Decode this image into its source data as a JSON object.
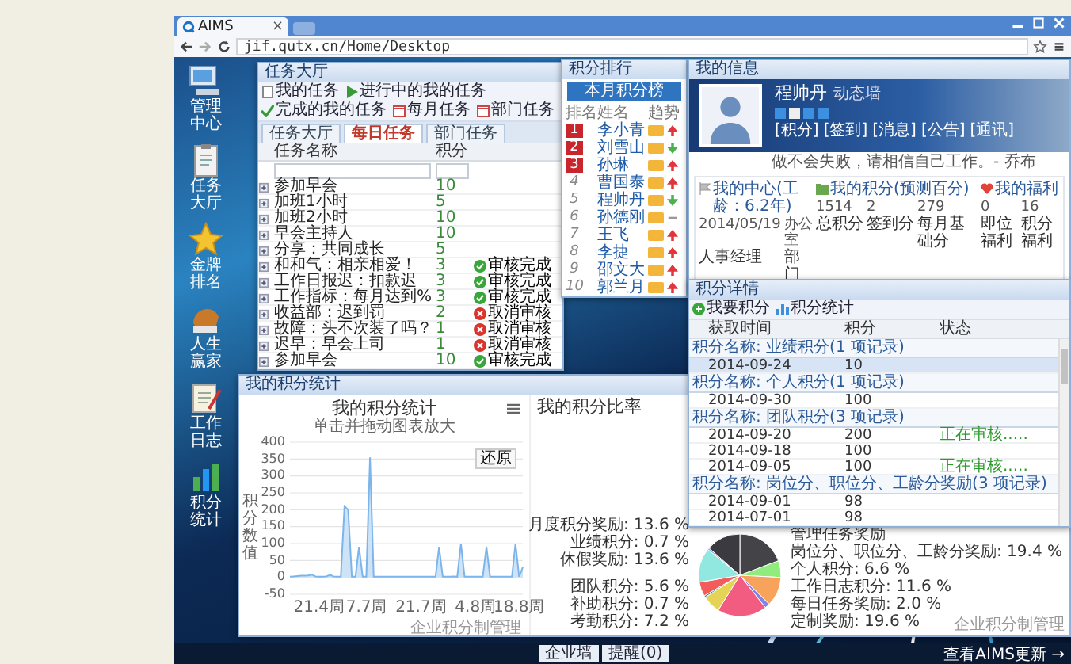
{
  "browser": {
    "tab_title": "AIMS",
    "tab_close": "×",
    "address": "jif.qutx.cn/Home/Desktop"
  },
  "desktop_icons": [
    {
      "label": "管理中心",
      "kind": "computer"
    },
    {
      "label": "任务大厅",
      "kind": "clipboard"
    },
    {
      "label": "金牌排名",
      "kind": "star"
    },
    {
      "label": "人生赢家",
      "kind": "glove"
    },
    {
      "label": "工作日志",
      "kind": "notepad"
    },
    {
      "label": "积分统计",
      "kind": "chart"
    }
  ],
  "task_window": {
    "title": "任务大厅",
    "toolbar": [
      {
        "label": "我的任务",
        "kind": "page"
      },
      {
        "label": "进行中的我的任务",
        "kind": "play"
      },
      {
        "label": "完成的我的任务",
        "kind": "check"
      },
      {
        "label": "每月任务",
        "kind": "calendar"
      },
      {
        "label": "部门任务",
        "kind": "calendar"
      }
    ],
    "tabs": [
      {
        "label": "任务大厅",
        "selected": false
      },
      {
        "label": "每日任务",
        "selected": true
      },
      {
        "label": "部门任务",
        "selected": false
      }
    ],
    "columns": [
      "任务名称",
      "积分"
    ],
    "rows": [
      {
        "name": "参加早会",
        "points": "10"
      },
      {
        "name": "加班1小时",
        "points": "5"
      },
      {
        "name": "加班2小时",
        "points": "10"
      },
      {
        "name": "早会主持人",
        "points": "10"
      },
      {
        "name": "分享：共同成长",
        "points": "5"
      },
      {
        "name": "和和气：相亲相爱！",
        "points": "3",
        "status": {
          "kind": "approved",
          "label": "审核完成"
        }
      },
      {
        "name": "工作日报迟：扣款迟",
        "points": "3",
        "status": {
          "kind": "approved",
          "label": "审核完成"
        }
      },
      {
        "name": "工作指标：每月达到%",
        "points": "3",
        "status": {
          "kind": "approved",
          "label": "审核完成"
        }
      },
      {
        "name": "收益部：迟到罚",
        "points": "2",
        "status": {
          "kind": "rejected",
          "label": "取消审核"
        }
      },
      {
        "name": "故障：头不次装了吗？",
        "points": "1",
        "status": {
          "kind": "rejected",
          "label": "取消审核"
        }
      },
      {
        "name": "迟早：早会上司",
        "points": "1",
        "status": {
          "kind": "rejected",
          "label": "取消审核"
        }
      },
      {
        "name": "参加早会",
        "points": "10",
        "status": {
          "kind": "approved",
          "label": "审核完成"
        }
      }
    ]
  },
  "ranking_window": {
    "title": "积分排行",
    "button": "本月积分榜",
    "columns": [
      "排名",
      "姓名",
      "趋势"
    ],
    "rows": [
      {
        "rank": "1",
        "top": true,
        "name": "李小青",
        "kind": "up"
      },
      {
        "rank": "2",
        "top": true,
        "name": "刘雪山",
        "kind": "down"
      },
      {
        "rank": "3",
        "top": true,
        "name": "孙琳",
        "kind": "up"
      },
      {
        "rank": "4",
        "top": false,
        "name": "曹国泰",
        "kind": "up"
      },
      {
        "rank": "5",
        "top": false,
        "name": "程帅丹",
        "kind": "down"
      },
      {
        "rank": "6",
        "top": false,
        "name": "孙德刚",
        "kind": "flat"
      },
      {
        "rank": "7",
        "top": false,
        "name": "王飞",
        "kind": "up"
      },
      {
        "rank": "8",
        "top": false,
        "name": "李捷",
        "kind": "up"
      },
      {
        "rank": "9",
        "top": false,
        "name": "邵文大",
        "kind": "up"
      },
      {
        "rank": "10",
        "top": false,
        "name": "郭兰月",
        "kind": "up"
      }
    ]
  },
  "info_window": {
    "title": "我的信息",
    "name": "程帅丹",
    "tag": "动态墙",
    "links": [
      "[积分]",
      "[签到]",
      "[消息]",
      "[公告]",
      "[通讯]"
    ],
    "motto": "做不会失败，请相信自己工作。- 乔布",
    "panels": [
      {
        "kind": "center",
        "title": "我的中心(工龄：6.2年)",
        "values": [
          "2014/05/19",
          "办公室"
        ],
        "labels": [
          "人事经理",
          "部门"
        ]
      },
      {
        "kind": "points",
        "title": "我的积分(预测百分)",
        "values": [
          "1514",
          "2",
          "279"
        ],
        "labels": [
          "总积分",
          "签到分",
          "每月基础分"
        ]
      },
      {
        "kind": "welfare",
        "title": "我的福利",
        "values": [
          "0",
          "16"
        ],
        "labels": [
          "即位福利",
          "积分福利"
        ]
      }
    ]
  },
  "detail_window": {
    "title": "积分详情",
    "toolbar": [
      {
        "label": "我要积分",
        "kind": "add"
      },
      {
        "label": "积分统计",
        "kind": "chart"
      }
    ],
    "columns": [
      "获取时间",
      "积分",
      "状态"
    ],
    "groups": [
      {
        "title": "积分名称: 业绩积分(1 项记录)",
        "rows": [
          {
            "date": "2014-09-24",
            "points": "10",
            "selected": true
          }
        ]
      },
      {
        "title": "积分名称: 个人积分(1 项记录)",
        "rows": [
          {
            "date": "2014-09-30",
            "points": "100",
            "selected": false
          }
        ]
      },
      {
        "title": "积分名称: 团队积分(3 项记录)",
        "rows": [
          {
            "date": "2014-09-20",
            "points": "200",
            "status": "正在审核.....",
            "selected": false
          },
          {
            "date": "2014-09-18",
            "points": "100",
            "selected": false
          },
          {
            "date": "2014-09-05",
            "points": "100",
            "status": "正在审核.....",
            "selected": false
          }
        ]
      },
      {
        "title": "积分名称: 岗位分、职位分、工龄分奖励(3 项记录)",
        "rows": [
          {
            "date": "2014-09-01",
            "points": "98",
            "selected": false
          },
          {
            "date": "2014-07-01",
            "points": "98",
            "selected": false
          }
        ]
      }
    ]
  },
  "chart_window": {
    "title": "我的积分统计",
    "line": {
      "subtitle": "单击并拖动图表放大",
      "reset_button": "还原",
      "credit": "企业积分制管理",
      "chart_data": {
        "type": "area",
        "title": "我的积分统计",
        "grid": true,
        "ylabel": "积分数值",
        "ylim": [
          -50,
          400
        ],
        "yticks": [
          -50,
          0,
          50,
          100,
          150,
          200,
          250,
          300,
          350,
          400
        ],
        "categories": [
          null,
          null,
          null,
          null,
          null,
          null,
          null,
          null,
          "21.4周",
          null,
          null,
          null,
          null,
          null,
          null,
          null,
          null,
          null,
          null,
          null,
          null,
          "7.7周",
          null,
          null,
          null,
          null,
          null,
          null,
          null,
          null,
          null,
          null,
          null,
          null,
          null,
          null,
          "21.7周",
          null,
          null,
          null,
          null,
          null,
          null,
          null,
          null,
          null,
          null,
          null,
          null,
          null,
          null,
          "4.8周",
          null,
          null,
          null,
          null,
          null,
          null,
          null,
          null,
          null,
          null,
          null,
          "18.8周",
          null
        ],
        "values": [
          2,
          3,
          4,
          5,
          5,
          6,
          8,
          3,
          2,
          2,
          3,
          7,
          3,
          2,
          2,
          210,
          200,
          2,
          2,
          90,
          2,
          2,
          355,
          2,
          2,
          2,
          2,
          2,
          2,
          2,
          2,
          2,
          2,
          2,
          2,
          2,
          2,
          2,
          2,
          2,
          2,
          90,
          2,
          2,
          2,
          3,
          2,
          100,
          2,
          2,
          2,
          2,
          2,
          2,
          90,
          2,
          2,
          2,
          2,
          2,
          2,
          2,
          100,
          2,
          30
        ]
      }
    },
    "pie": {
      "credit": "企业积分制管理",
      "chart_data": {
        "type": "pie",
        "title": "我的积分比率",
        "data_labels": true,
        "value_labels": [
          null,
          "19.4 %",
          "6.6 %",
          "11.6 %",
          "2.0 %",
          "19.6 %",
          "7.2 %",
          "0.7 %",
          "5.6 %",
          "13.6 %",
          "0.7 %",
          "13.6 %"
        ],
        "categories": [
          "管理任务奖励",
          "岗位分、职位分、工龄分奖励",
          "个人积分",
          "工作日志积分",
          "每日任务奖励",
          "定制奖励",
          "考勤积分",
          "补助积分",
          "团队积分",
          "休假奖励",
          "业绩积分",
          "月度积分奖励"
        ],
        "values": [
          null,
          19.4,
          6.6,
          11.6,
          2.0,
          19.6,
          7.2,
          0.7,
          5.6,
          13.6,
          0.7,
          13.6
        ]
      }
    }
  },
  "taskbar": {
    "buttons": [
      "企业墙",
      "提醒(0)"
    ],
    "update_link": "查看AIMS更新 →"
  }
}
